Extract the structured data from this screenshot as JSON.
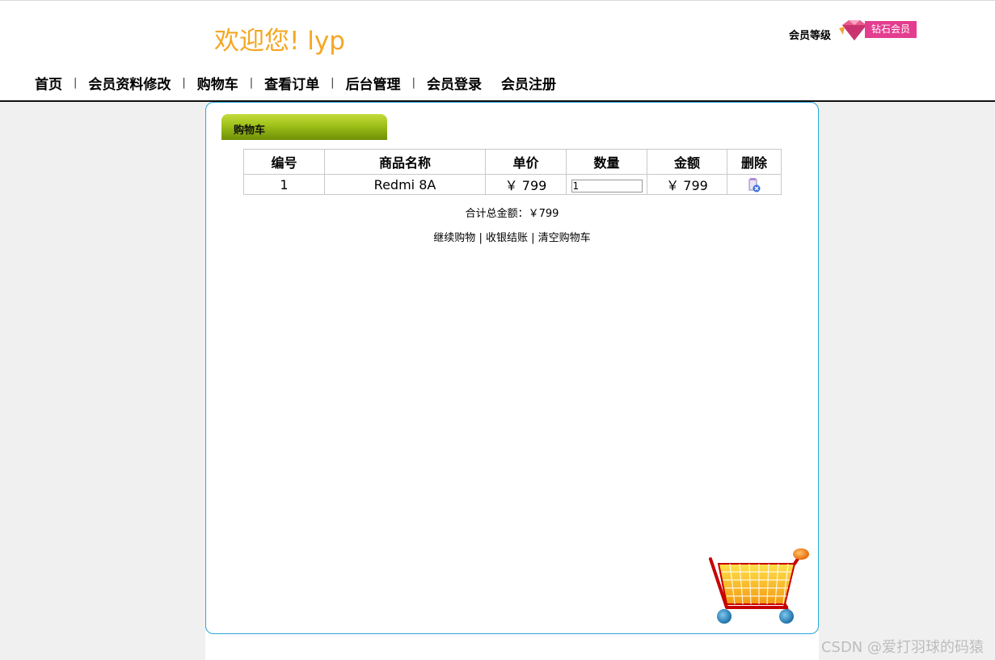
{
  "header": {
    "welcome": "欢迎您! lyp",
    "member_level_label": "会员等级",
    "member_badge": "钻石会员"
  },
  "nav": {
    "items": [
      "首页",
      "会员资料修改",
      "购物车",
      "查看订单",
      "后台管理",
      "会员登录",
      "会员注册"
    ],
    "separator": "|"
  },
  "panel": {
    "tab_title": "购物车",
    "table": {
      "headers": [
        "编号",
        "商品名称",
        "单价",
        "数量",
        "金额",
        "删除"
      ],
      "rows": [
        {
          "id": "1",
          "name": "Redmi 8A",
          "price": "￥ 799",
          "quantity": "1",
          "amount": "￥ 799"
        }
      ]
    },
    "total_text": "合计总金额：￥799",
    "links": {
      "continue": "继续购物",
      "checkout": "收银结账",
      "clear": "清空购物车",
      "separator": "|"
    }
  },
  "watermark": "CSDN @爱打羽球的码猿",
  "colors": {
    "welcome": "#f5a623",
    "panel_border": "#29a8d6",
    "tab_green": "#9ec018",
    "badge_pink": "#e43d8f"
  }
}
